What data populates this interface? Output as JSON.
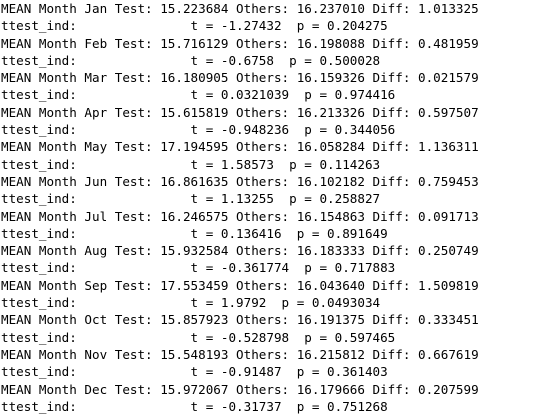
{
  "output": {
    "lines": [
      "MEAN Month Jan Test: 15.223684 Others: 16.237010 Diff: 1.013325",
      "ttest_ind:               t = -1.27432  p = 0.204275",
      "MEAN Month Feb Test: 15.716129 Others: 16.198088 Diff: 0.481959",
      "ttest_ind:               t = -0.6758  p = 0.500028",
      "MEAN Month Mar Test: 16.180905 Others: 16.159326 Diff: 0.021579",
      "ttest_ind:               t = 0.0321039  p = 0.974416",
      "MEAN Month Apr Test: 15.615819 Others: 16.213326 Diff: 0.597507",
      "ttest_ind:               t = -0.948236  p = 0.344056",
      "MEAN Month May Test: 17.194595 Others: 16.058284 Diff: 1.136311",
      "ttest_ind:               t = 1.58573  p = 0.114263",
      "MEAN Month Jun Test: 16.861635 Others: 16.102182 Diff: 0.759453",
      "ttest_ind:               t = 1.13255  p = 0.258827",
      "MEAN Month Jul Test: 16.246575 Others: 16.154863 Diff: 0.091713",
      "ttest_ind:               t = 0.136416  p = 0.891649",
      "MEAN Month Aug Test: 15.932584 Others: 16.183333 Diff: 0.250749",
      "ttest_ind:               t = -0.361774  p = 0.717883",
      "MEAN Month Sep Test: 17.553459 Others: 16.043640 Diff: 1.509819",
      "ttest_ind:               t = 1.9792  p = 0.0493034",
      "MEAN Month Oct Test: 15.857923 Others: 16.191375 Diff: 0.333451",
      "ttest_ind:               t = -0.528798  p = 0.597465",
      "MEAN Month Nov Test: 15.548193 Others: 16.215812 Diff: 0.667619",
      "ttest_ind:               t = -0.91487  p = 0.361403",
      "MEAN Month Dec Test: 15.972067 Others: 16.179666 Diff: 0.207599",
      "ttest_ind:               t = -0.31737  p = 0.751268"
    ]
  }
}
